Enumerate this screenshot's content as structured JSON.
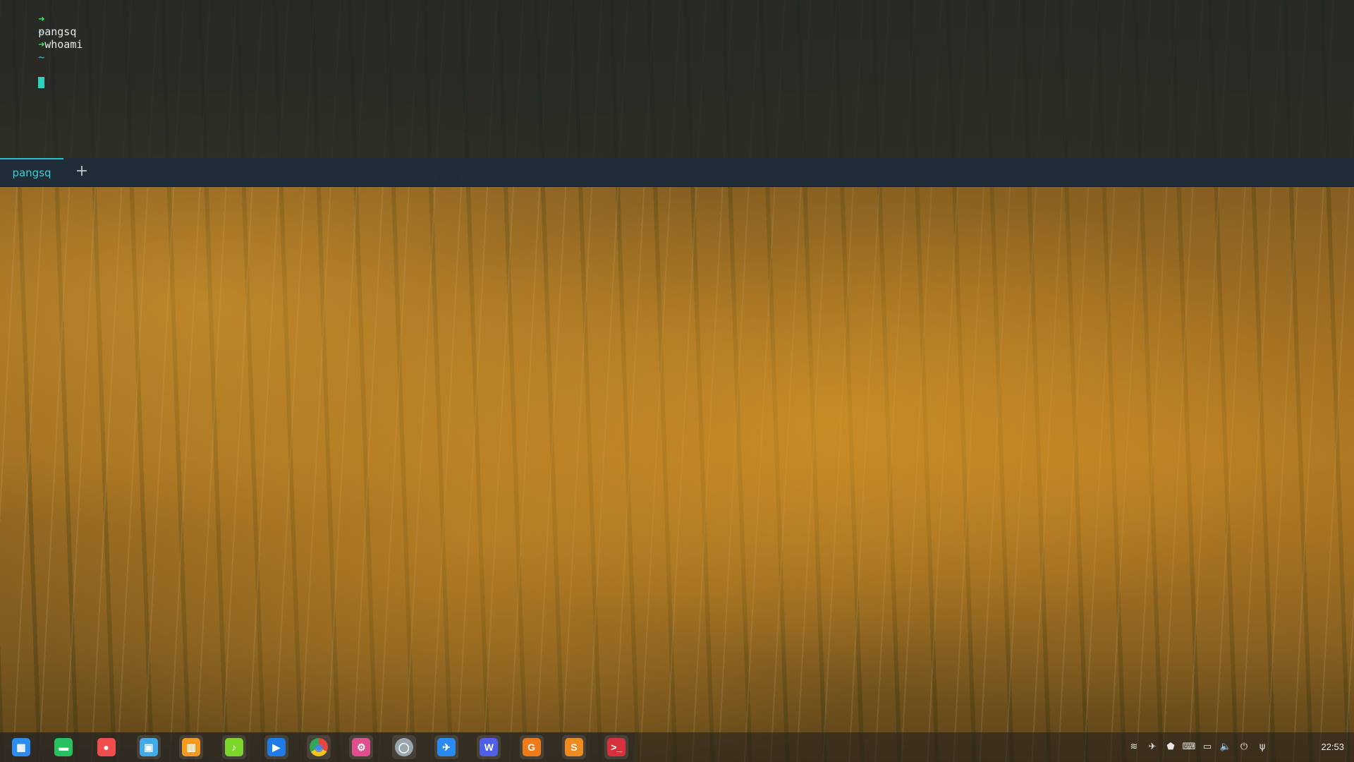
{
  "terminal": {
    "lines": [
      {
        "arrow": "➜",
        "tilde": "~",
        "text": " whoami"
      },
      {
        "output": "pangsq"
      },
      {
        "arrow": "➜",
        "tilde": "~",
        "text": " "
      }
    ],
    "tabs": [
      {
        "label": "pangsq"
      }
    ],
    "add_tab_label": "+"
  },
  "dock": {
    "apps": [
      {
        "name": "launcher-icon",
        "glyph": "▦",
        "color": "#2d8cf0"
      },
      {
        "name": "file-manager-icon",
        "glyph": "▬",
        "color": "#27c25f"
      },
      {
        "name": "screen-recorder-icon",
        "glyph": "●",
        "color": "#f04e4e"
      },
      {
        "name": "app-store-icon",
        "glyph": "▣",
        "color": "#43a9e8"
      },
      {
        "name": "archive-manager-icon",
        "glyph": "▥",
        "color": "#f59a1e"
      },
      {
        "name": "music-icon",
        "glyph": "♪",
        "color": "#7cd62a"
      },
      {
        "name": "video-player-icon",
        "glyph": "▶",
        "color": "#1f7be8"
      },
      {
        "name": "chrome-icon",
        "glyph": "◉",
        "color": "#f2f2f2"
      },
      {
        "name": "settings-icon",
        "glyph": "⚙",
        "color": "#e04e8e"
      },
      {
        "name": "browser-icon",
        "glyph": "◯",
        "color": "#9aa6ae"
      },
      {
        "name": "messenger-icon",
        "glyph": "✈",
        "color": "#2a8af0"
      },
      {
        "name": "wps-writer-icon",
        "glyph": "W",
        "color": "#4f5fe6"
      },
      {
        "name": "wps-presentation-icon",
        "glyph": "G",
        "color": "#f07a18"
      },
      {
        "name": "sublime-text-icon",
        "glyph": "S",
        "color": "#ee8a1e"
      },
      {
        "name": "terminal-icon",
        "glyph": ">_",
        "color": "#d9303d"
      }
    ],
    "tray": [
      {
        "name": "wifi-icon",
        "glyph": "≋"
      },
      {
        "name": "telegram-icon",
        "glyph": "✈"
      },
      {
        "name": "vpn-shield-icon",
        "glyph": "⬟"
      },
      {
        "name": "keyboard-icon",
        "glyph": "⌨"
      },
      {
        "name": "battery-icon",
        "glyph": "▭"
      },
      {
        "name": "volume-muted-icon",
        "glyph": "🔈"
      },
      {
        "name": "power-icon",
        "glyph": "⏻"
      },
      {
        "name": "usb-icon",
        "glyph": "ψ"
      }
    ],
    "clock": "22:53"
  }
}
